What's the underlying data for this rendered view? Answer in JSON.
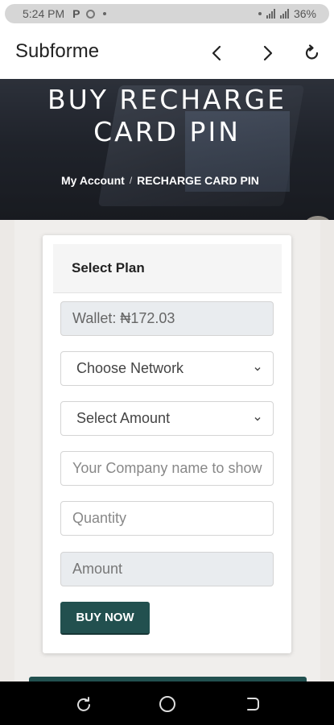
{
  "status_bar": {
    "time": "5:24 PM",
    "p_icon": "P",
    "battery": "36%",
    "icons": [
      "whatsapp-icon",
      "dot-icon",
      "signal-icon",
      "battery-icon"
    ]
  },
  "app_bar": {
    "title": "Subforme",
    "icons": [
      "back-arrow-icon",
      "forward-arrow-icon",
      "refresh-icon"
    ]
  },
  "hero": {
    "title_line1": "BUY RECHARGE",
    "title_line2": "CARD PIN",
    "breadcrumb": {
      "home": "My Account",
      "separator": "/",
      "current": "RECHARGE CARD PIN"
    }
  },
  "form": {
    "header": "Select Plan",
    "wallet": "Wallet: ₦172.03",
    "network_select": "Choose Network",
    "amount_select": "Select Amount",
    "company_placeholder": "Your Company name to show",
    "quantity_placeholder": "Quantity",
    "amount_placeholder": "Amount",
    "buy_button": "BUY NOW"
  },
  "colors": {
    "accent": "#22504f",
    "background": "#ece9e6",
    "readonly": "#e9ecef"
  },
  "nav_bar": {
    "icons": [
      "recents-icon",
      "home-icon",
      "back-icon"
    ]
  }
}
